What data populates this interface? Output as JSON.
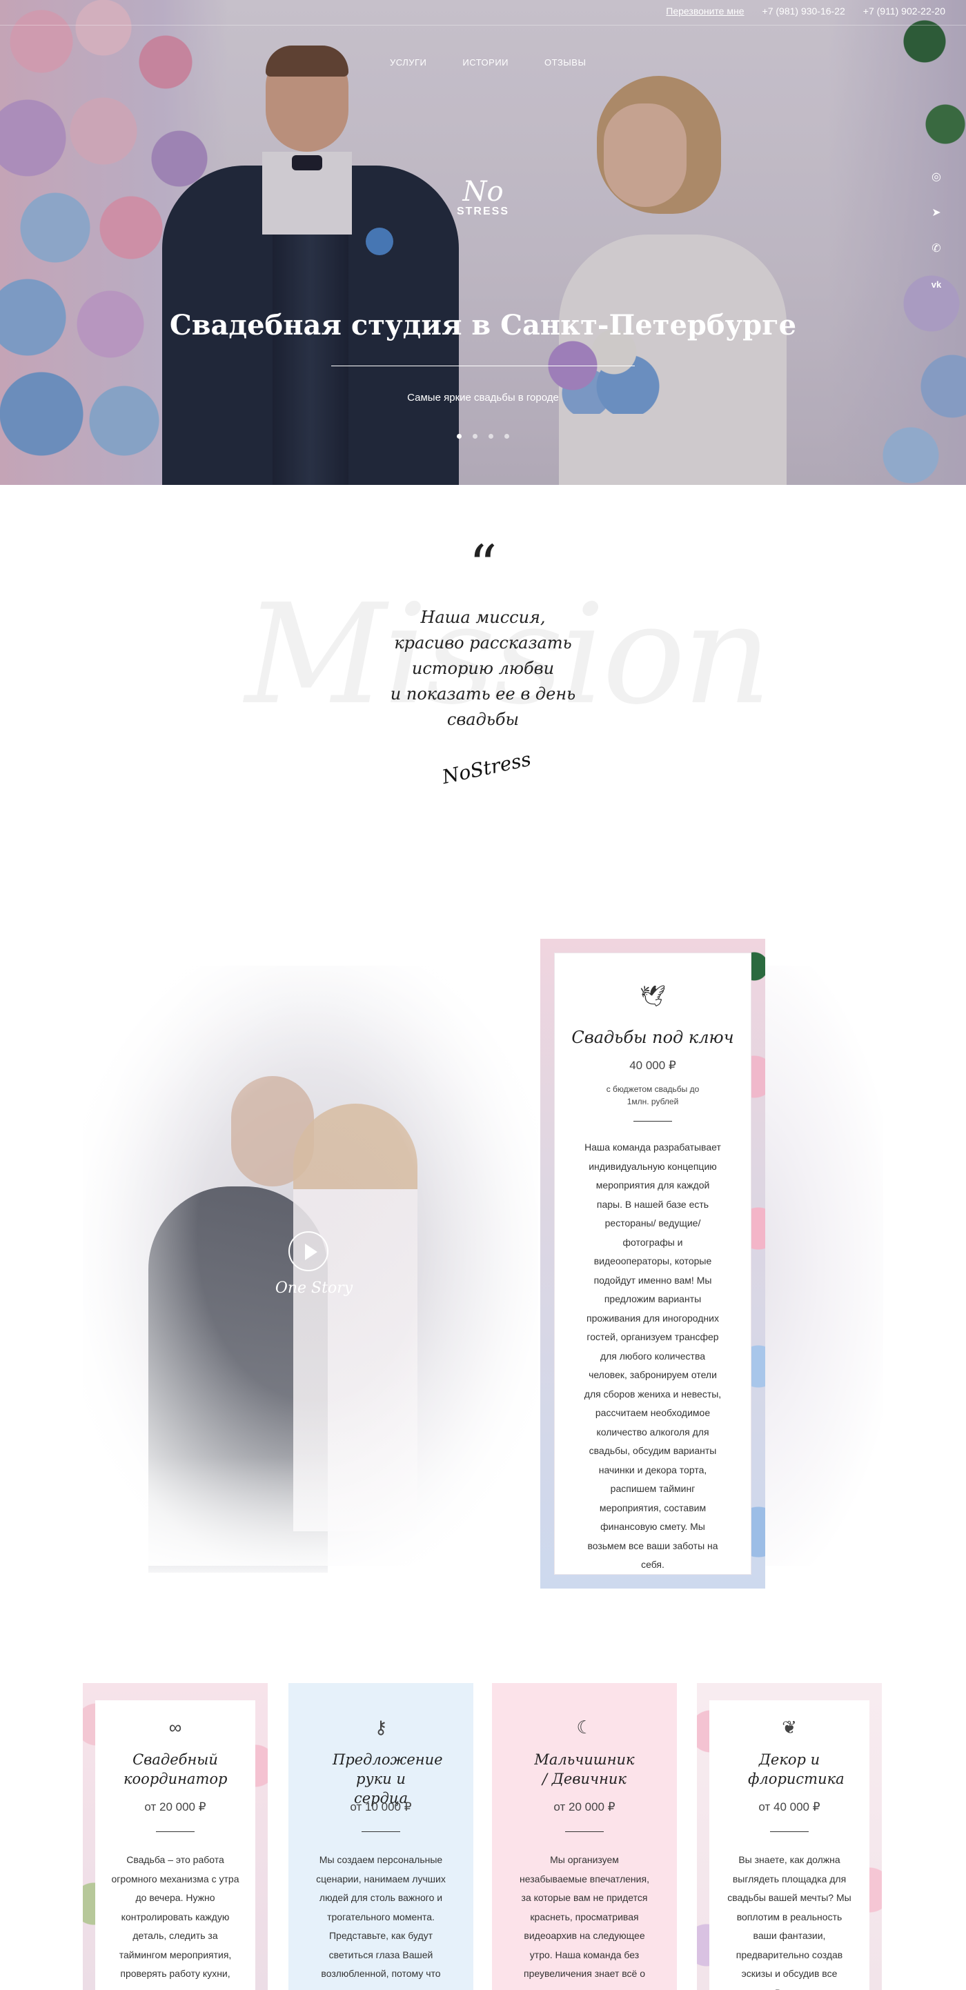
{
  "header": {
    "callback_label": "Перезвоните мне",
    "phone_1": "+7 (981) 930-16-22",
    "phone_2": "+7 (911) 902-22-20",
    "nav": [
      "УСЛУГИ",
      "ИСТОРИИ",
      "ОТЗЫВЫ"
    ],
    "logo_mark": "No",
    "logo_word": "STRESS"
  },
  "socials": [
    {
      "icon": "instagram-icon",
      "glyph": "◎"
    },
    {
      "icon": "telegram-icon",
      "glyph": "➤"
    },
    {
      "icon": "whatsapp-icon",
      "glyph": "✆"
    },
    {
      "icon": "vk-icon",
      "glyph": "vk"
    }
  ],
  "hero": {
    "title": "Свадебная студия в Санкт-Петербурге",
    "subtitle": "Самые яркие свадьбы в городе",
    "slides": 4,
    "active_slide": 1
  },
  "mission": {
    "quote_mark": "“",
    "bg_word": "Mission",
    "lines": [
      "Наша миссия,",
      "красиво рассказать",
      "иcторию любви",
      "и показать ее в день",
      "свадьбы"
    ],
    "signature": "NoStress"
  },
  "featured": {
    "play_caption": "One Story",
    "icon": "dove-icon",
    "icon_glyph": "🕊",
    "title": "Свадьбы под ключ",
    "price": "40 000 ₽",
    "note": "с бюджетом свадьбы до 1млн. рублей",
    "description": "Наша команда разрабатывает индивидуальную концепцию мероприятия для каждой пары. В нашей базе есть рестораны/ ведущие/ фотографы и видеооператоры, которые подойдут именно вам! Мы предложим варианты проживания для иногородних гостей, организуем трансфер для любого количества человек, забронируем отели для сборов жениха и невесты, рассчитаем необходимое количество алкоголя для свадьбы, обсудим варианты начинки и декора торта, распишем тайминг мероприятия, составим финансовую смету. Мы возьмем все ваши заботы на себя."
  },
  "services": [
    {
      "icon": "rings-icon",
      "glyph": "∞",
      "title": "Свадебный координатор",
      "price": "от 20 000 ₽",
      "description": "Свадьба – это работа огромного механизма с утра до вечера. Нужно контролировать каждую деталь, следить за таймингом мероприятия, проверять работу кухни, организовать"
    },
    {
      "icon": "key-icon",
      "glyph": "⚷",
      "title": "Предложение руки и сердца",
      "price": "от 10 000 ₽",
      "description": "Мы создаем персональные сценарии, нанимаем лучших людей для столь важного и трогательного момента. Представьте, как будут светиться глаза Вашей возлюбленной, потому что ее"
    },
    {
      "icon": "moon-star-icon",
      "glyph": "☾",
      "title": "Мальчишник / Девичник",
      "price": "от 20 000 ₽",
      "description": "Мы организуем незабываемые впечатления, за которые вам не придется краснеть, просматривая видеоархив на следующее утро. Наша команда без преувеличения знает всё о том, как хорошо"
    },
    {
      "icon": "heart-ornament-icon",
      "glyph": "❦",
      "title": "Декор и флористика",
      "price": "от 40 000 ₽",
      "description": "Вы знаете, как должна выглядеть площадка для свадьбы вашей мечты? Мы воплотим в реальность ваши фантазии, предварительно создав эскизы и обсудив все детали. Вы понятие не имеете,"
    }
  ],
  "colors": {
    "card_bg_blue": "#e6f1fa",
    "card_bg_pink": "#fce3ea",
    "text_dark": "#222222"
  }
}
